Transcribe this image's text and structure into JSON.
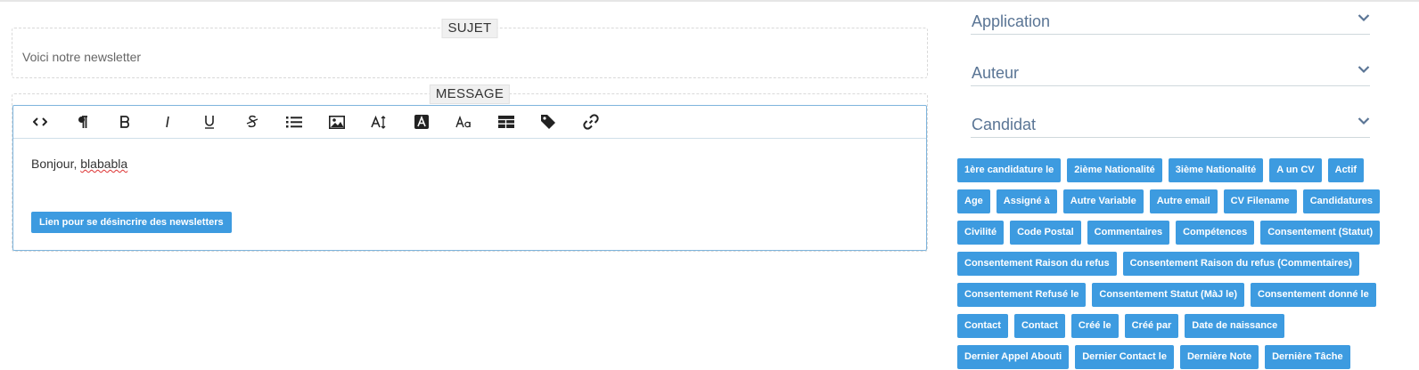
{
  "subject": {
    "legend": "SUJET",
    "value": "Voici notre newsletter"
  },
  "message": {
    "legend": "MESSAGE",
    "toolbar": [
      {
        "name": "code-view-icon",
        "glyph": "<>"
      },
      {
        "name": "paragraph-icon",
        "glyph": "¶"
      },
      {
        "name": "bold-icon",
        "glyph": "B"
      },
      {
        "name": "italic-icon",
        "glyph": "I"
      },
      {
        "name": "underline-icon",
        "glyph": "U"
      },
      {
        "name": "strikethrough-icon",
        "glyph": "S"
      },
      {
        "name": "list-icon",
        "glyph": "list"
      },
      {
        "name": "image-icon",
        "glyph": "image"
      },
      {
        "name": "font-size-icon",
        "glyph": "A↕"
      },
      {
        "name": "text-color-icon",
        "glyph": "A"
      },
      {
        "name": "font-family-icon",
        "glyph": "Aa"
      },
      {
        "name": "table-icon",
        "glyph": "table"
      },
      {
        "name": "tag-icon",
        "glyph": "tag"
      },
      {
        "name": "link-icon",
        "glyph": "link"
      }
    ],
    "body_prefix": "Bonjour, ",
    "body_misspelled": "blababla",
    "unsubscribe_label": "Lien pour se désincrire des newsletters"
  },
  "accordions": [
    {
      "title": "Application"
    },
    {
      "title": "Auteur"
    },
    {
      "title": "Candidat"
    }
  ],
  "colors": {
    "accent": "#3d9be0",
    "accordion_title": "#5a7595"
  },
  "tags": [
    "1ère candidature le",
    "2ième Nationalité",
    "3ième Nationalité",
    "A un CV",
    "Actif",
    "Age",
    "Assigné à",
    "Autre Variable",
    "Autre email",
    "CV Filename",
    "Candidatures",
    "Civilité",
    "Code Postal",
    "Commentaires",
    "Compétences",
    "Consentement (Statut)",
    "Consentement Raison du refus",
    "Consentement Raison du refus (Commentaires)",
    "Consentement Refusé le",
    "Consentement Statut (MàJ le)",
    "Consentement donné le",
    "Contact",
    "Contact",
    "Créé le",
    "Créé par",
    "Date de naissance",
    "Dernier Appel Abouti",
    "Dernier Contact le",
    "Dernière Note",
    "Dernière Tâche"
  ]
}
